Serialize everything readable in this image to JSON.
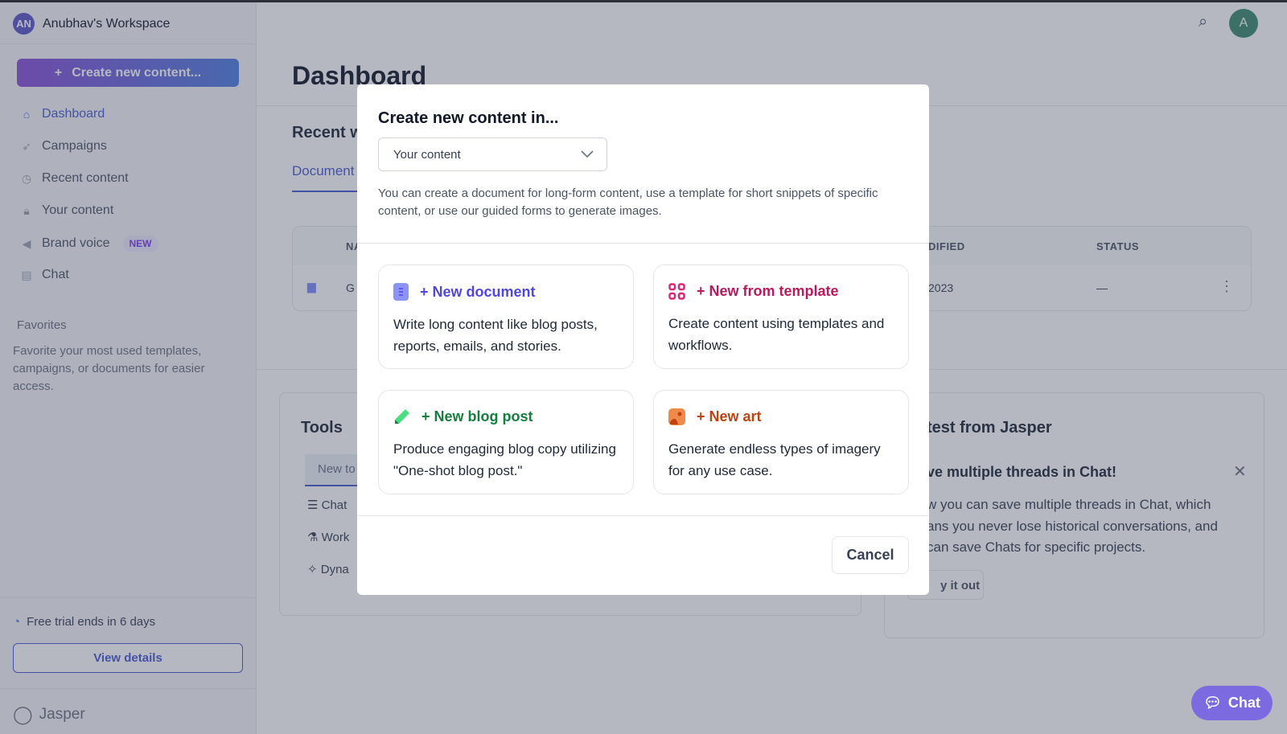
{
  "workspace": {
    "initials": "AN",
    "name": "Anubhav's Workspace"
  },
  "sidebar": {
    "create_label": "Create new content...",
    "items": [
      {
        "label": "Dashboard",
        "icon": "home-icon",
        "active": true
      },
      {
        "label": "Campaigns",
        "icon": "rocket-icon"
      },
      {
        "label": "Recent content",
        "icon": "clock-icon"
      },
      {
        "label": "Your content",
        "icon": "lock-icon"
      },
      {
        "label": "Brand voice",
        "icon": "megaphone-icon",
        "badge": "NEW"
      },
      {
        "label": "Chat",
        "icon": "chat-icon"
      }
    ],
    "favorites_title": "Favorites",
    "favorites_desc": "Favorite your most used templates, campaigns, or documents for easier access.",
    "trial_text": "Free trial ends in 6 days",
    "view_details": "View details",
    "brand": "Jasper"
  },
  "header": {
    "avatar": "A"
  },
  "main": {
    "title": "Dashboard",
    "recent_title": "Recent w",
    "tab": "Document",
    "table": {
      "col_name": "NA",
      "col_modified": "DIFIED",
      "col_status": "STATUS",
      "row": {
        "name": "G",
        "modified": "2023",
        "status": "—"
      }
    },
    "tools": {
      "title": "Tools",
      "tab": "New to",
      "items": [
        "Chat",
        "Work",
        "Dyna"
      ]
    },
    "latest": {
      "title": "test from Jasper",
      "headline": "ve multiple threads in Chat!",
      "body_lines": [
        "w you can save multiple threads in Chat, which",
        "ans you never lose historical conversations, and",
        "can save Chats for specific projects."
      ],
      "try": "y it out"
    }
  },
  "modal": {
    "title": "Create new content in...",
    "select_value": "Your content",
    "description": "You can create a document for long-form content, use a template for short snippets of specific content, or use our guided forms to generate images.",
    "options": [
      {
        "title": "+ New document",
        "desc": "Write long content like blog posts, reports, emails, and stories.",
        "color": "#4f46e5"
      },
      {
        "title": "+ New from template",
        "desc": "Create content using templates and workflows.",
        "color": "#be185d"
      },
      {
        "title": "+ New blog post",
        "desc": "Produce engaging blog copy utilizing \"One-shot blog post.\"",
        "color": "#15803d"
      },
      {
        "title": "+ New art",
        "desc": "Generate endless types of imagery for any use case.",
        "color": "#c2410c"
      }
    ],
    "cancel": "Cancel"
  },
  "chat_button": "Chat"
}
